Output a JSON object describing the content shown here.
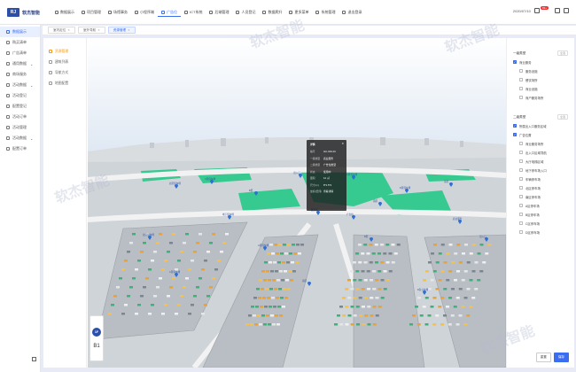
{
  "header": {
    "logo_mark": "RJ",
    "logo_text": "软杰智能",
    "nav": [
      {
        "label": "数据展示",
        "icon": "dashboard-icon",
        "active": false
      },
      {
        "label": "项目管理",
        "icon": "list-icon",
        "active": false
      },
      {
        "label": "场馆事务",
        "icon": "building-icon",
        "active": false
      },
      {
        "label": "小程序端",
        "icon": "share-icon",
        "active": false
      },
      {
        "label": "广告位",
        "icon": "ad-icon",
        "active": true
      },
      {
        "label": "ICT系统",
        "icon": "network-icon",
        "active": false
      },
      {
        "label": "后端管理",
        "icon": "server-icon",
        "active": false
      },
      {
        "label": "人员登记",
        "icon": "person-icon",
        "active": false
      },
      {
        "label": "数据爬升",
        "icon": "chart-icon",
        "active": false
      },
      {
        "label": "更多菜单",
        "icon": "menu-icon",
        "active": false
      },
      {
        "label": "系统管理",
        "icon": "gear-icon",
        "active": false
      },
      {
        "label": "退出登录",
        "icon": "logout-icon",
        "active": false
      }
    ],
    "date": "2020/07/10",
    "badge": "99+"
  },
  "sidebar": {
    "items": [
      {
        "label": "数据展示",
        "active": true
      },
      {
        "label": "购买清单",
        "active": false
      },
      {
        "label": "广告清单",
        "active": false
      },
      {
        "label": "通用数据",
        "active": false,
        "chevron": true
      },
      {
        "label": "商场服务",
        "active": false
      },
      {
        "label": "活动数据",
        "active": false,
        "chevron": true
      },
      {
        "label": "活动登记",
        "active": false
      },
      {
        "label": "配置登记",
        "active": false
      },
      {
        "label": "活动订单",
        "active": false
      },
      {
        "label": "活动管理",
        "active": false
      },
      {
        "label": "活动数据",
        "active": false,
        "chevron": true
      },
      {
        "label": "配置订单",
        "active": false
      }
    ]
  },
  "tabs": [
    {
      "label": "室内定位",
      "active": false
    },
    {
      "label": "室外导航",
      "active": false
    },
    {
      "label": "资源管理",
      "active": true
    }
  ],
  "submenu": [
    {
      "label": "资源管理",
      "active": true
    },
    {
      "label": "建筑列表",
      "active": false
    },
    {
      "label": "导航方式",
      "active": false
    },
    {
      "label": "地图配置",
      "active": false
    }
  ],
  "popup": {
    "title": "详情",
    "rows": [
      {
        "k": "编号",
        "v": "GC-019-01"
      },
      {
        "k": "一级类型",
        "v": "商业服务"
      },
      {
        "k": "二级类型",
        "v": "广告位类型"
      },
      {
        "k": "状态",
        "v": "使用中"
      },
      {
        "k": "面积",
        "v": "12 ㎡"
      },
      {
        "k": "尺寸(m)",
        "v": "8*1.5*2"
      },
      {
        "k": "坐标(经纬)",
        "v": "查看详情"
      }
    ]
  },
  "floors": {
    "active": "1F",
    "other": "B1"
  },
  "right_panel": {
    "group1_title": "一级类型",
    "group1_all": "全选",
    "group1_items": [
      {
        "label": "商业服务",
        "checked": true,
        "indent": false
      },
      {
        "label": "服务设施",
        "checked": false,
        "indent": true
      },
      {
        "label": "餐饮场所",
        "checked": false,
        "indent": true
      },
      {
        "label": "商业设施",
        "checked": false,
        "indent": true
      },
      {
        "label": "商户服务场所",
        "checked": false,
        "indent": true
      }
    ],
    "group2_title": "二级类型",
    "group2_all": "全选",
    "group2_items": [
      {
        "label": "所属出入口服务区域",
        "checked": true,
        "indent": false
      },
      {
        "label": "广告位置",
        "checked": true,
        "indent": false
      },
      {
        "label": "商业服务场所",
        "checked": false,
        "indent": true
      },
      {
        "label": "出入口区域导航",
        "checked": false,
        "indent": true
      },
      {
        "label": "大厅电梯区域",
        "checked": false,
        "indent": true
      },
      {
        "label": "地下停车场入口",
        "checked": false,
        "indent": true
      },
      {
        "label": "车辆停车场",
        "checked": false,
        "indent": true
      },
      {
        "label": "北区停车场",
        "checked": false,
        "indent": true
      },
      {
        "label": "南区停车场",
        "checked": false,
        "indent": true
      },
      {
        "label": "A区停车场",
        "checked": false,
        "indent": true
      },
      {
        "label": "B区停车场",
        "checked": false,
        "indent": true
      },
      {
        "label": "C区停车场",
        "checked": false,
        "indent": true
      },
      {
        "label": "D区停车场",
        "checked": false,
        "indent": true
      }
    ],
    "reset_label": "重置",
    "confirm_label": "保存"
  },
  "map_labels": [
    {
      "t": "北区停车场"
    },
    {
      "t": "A区停车场"
    },
    {
      "t": "B区"
    },
    {
      "t": "出入口"
    },
    {
      "t": "C区停车场"
    },
    {
      "t": "南区"
    },
    {
      "t": "D区停车场"
    },
    {
      "t": "东区"
    },
    {
      "t": "地下停车场"
    },
    {
      "t": "服务区"
    },
    {
      "t": "广告位"
    },
    {
      "t": "商业服务"
    }
  ],
  "watermark": "软杰智能"
}
